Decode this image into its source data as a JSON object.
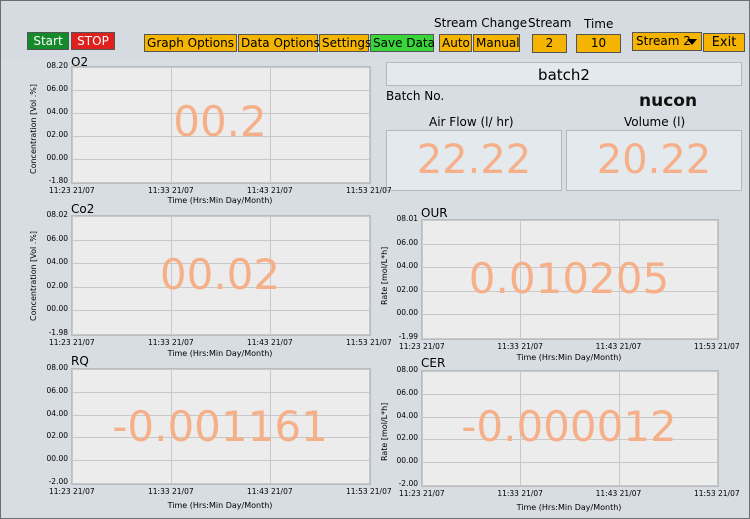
{
  "toolbar": {
    "start_label": "Start",
    "stop_label": "STOP",
    "graph_options_label": "Graph Options",
    "data_options_label": "Data Options",
    "settings_label": "Settings",
    "save_data_label": "Save Data",
    "stream_change_label": "Stream Change",
    "auto_label": "Auto",
    "manual_label": "Manual",
    "stream_label": "Stream",
    "stream_value": "2",
    "time_label": "Time",
    "time_value": "10",
    "stream_select_value": "Stream 2",
    "exit_label": "Exit"
  },
  "info": {
    "batch_name": "batch2",
    "batch_no_label": "Batch No.",
    "logo_text": "nucon",
    "airflow_label": "Air Flow (l/ hr)",
    "airflow_value": "22.22",
    "volume_label": "Volume (l)",
    "volume_value": "20.22"
  },
  "colors": {
    "accent_orange": "#f4b400",
    "start_green": "#158a2a",
    "stop_red": "#e0201c",
    "save_green": "#39d53a",
    "big_value": "#f5b08a"
  },
  "charts": {
    "o2": {
      "title": "O2",
      "ylabel": "Concentration [Vol .%]",
      "xlabel": "Time (Hrs:Min Day/Month)",
      "yticks": [
        "08.20",
        "06.00",
        "04.00",
        "02.00",
        "00.00",
        "-1.80"
      ],
      "xticks": [
        "11:23 21/07",
        "11:33 21/07",
        "11:43 21/07",
        "11:53 21/07"
      ],
      "value": "00.2"
    },
    "co2": {
      "title": "Co2",
      "ylabel": "Concentration [Vol .%]",
      "xlabel": "Time (Hrs:Min Day/Month)",
      "yticks": [
        "08.02",
        "06.00",
        "04.00",
        "02.00",
        "00.00",
        "-1.98"
      ],
      "xticks": [
        "11:23 21/07",
        "11:33 21/07",
        "11:43 21/07",
        "11:53 21/07"
      ],
      "value": "00.02"
    },
    "our": {
      "title": "OUR",
      "ylabel": "Rate [mol/L*h]",
      "xlabel": "Time (Hrs:Min Day/Month)",
      "yticks": [
        "08.01",
        "06.00",
        "04.00",
        "02.00",
        "00.00",
        "-1.99"
      ],
      "xticks": [
        "11:23 21/07",
        "11:33 21/07",
        "11:43 21/07",
        "11:53 21/07"
      ],
      "value": "0.010205"
    },
    "rq": {
      "title": "RQ",
      "ylabel": "",
      "xlabel": "Time (Hrs:Min Day/Month)",
      "yticks": [
        "08.00",
        "06.00",
        "04.00",
        "02.00",
        "00.00",
        "-2.00"
      ],
      "xticks": [
        "11:23 21/07",
        "11:33 21/07",
        "11:43 21/07",
        "11:53 21/07"
      ],
      "value": "-0.001161"
    },
    "cer": {
      "title": "CER",
      "ylabel": "Rate [mol/L*h]",
      "xlabel": "Time (Hrs:Min Day/Month)",
      "yticks": [
        "08.00",
        "06.00",
        "04.00",
        "02.00",
        "00.00",
        "-2.00"
      ],
      "xticks": [
        "11:23 21/07",
        "11:33 21/07",
        "11:43 21/07",
        "11:53 21/07"
      ],
      "value": "-0.000012"
    }
  }
}
